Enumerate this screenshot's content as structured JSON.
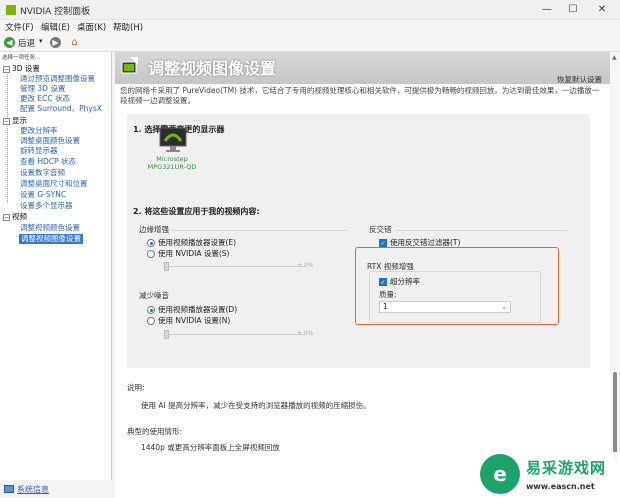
{
  "window": {
    "title": "NVIDIA 控制面板",
    "controls": {
      "minimize": "—",
      "maximize": "☐",
      "close": "✕"
    }
  },
  "menu": [
    "文件(F)",
    "编辑(E)",
    "桌面(K)",
    "帮助(H)"
  ],
  "toolbar": {
    "back_label": "后退",
    "back_dropdown": "▾"
  },
  "sidebar": {
    "task_header": "选择一项任务...",
    "categories": [
      {
        "label": "3D 设置",
        "items": [
          "通过预览调整图像设置",
          "管理 3D 设置",
          "更改 ECC 状态",
          "配置 Surround、PhysX"
        ]
      },
      {
        "label": "显示",
        "items": [
          "更改分辨率",
          "调整桌面颜色设置",
          "旋转显示器",
          "查看 HDCP 状态",
          "设置数字音频",
          "调整桌面尺寸和位置",
          "设置 G-SYNC",
          "设置多个显示器"
        ]
      },
      {
        "label": "视频",
        "items": [
          "调整视频颜色设置",
          "调整视频图像设置"
        ]
      }
    ],
    "selected": "调整视频图像设置"
  },
  "system_info": "系统信息",
  "main": {
    "title": "调整视频图像设置",
    "restore_defaults": "恢复默认设置",
    "intro": "您的网络卡采用了 PureVideo(TM) 技术，它结合了专用的视频处理核心和相关软件，可提供极为畅畅的视频回放。为达到最佳效果，一边播放一段视频一边调整设置。",
    "section1_title": "1. 选择需要变更的显示器",
    "monitor_name": "Microstep",
    "monitor_model": "MPG321UR-QD",
    "section2_title": "2. 将这些设置应用于我的视频内容:",
    "edge": {
      "label": "边缘增强",
      "option1": "使用视频播放器设置(E)",
      "option2": "使用 NVIDIA 设置(S)",
      "slider_value": "+ 0%"
    },
    "noise": {
      "label": "减少噪音",
      "option1": "使用视频播放器设置(D)",
      "option2": "使用 NVIDIA 设置(N)",
      "slider_value": "+ 0%"
    },
    "deinterlace": {
      "label": "反交错",
      "checkbox": "使用反交错过滤器(T)"
    },
    "rtx": {
      "label": "RTX 视频增强",
      "checkbox": "超分辨率",
      "quality_label": "质量:",
      "quality_value": "1"
    },
    "description_label": "说明:",
    "description_text": "使用 AI 提高分辨率，减少在受支持的浏览器播放的视频的压缩损伤。",
    "usage_label": "典型的使用情形:",
    "usage_text": "1440p 或更高分辨率面板上全屏视频回放"
  },
  "watermark": {
    "badge": "e",
    "title": "易采游戏网",
    "url": "www.eascn.net"
  },
  "colors": {
    "nvidia_green": "#76b900",
    "selection": "#3478d4",
    "highlight_box": "#e06a2a",
    "link": "#2b62b6"
  }
}
